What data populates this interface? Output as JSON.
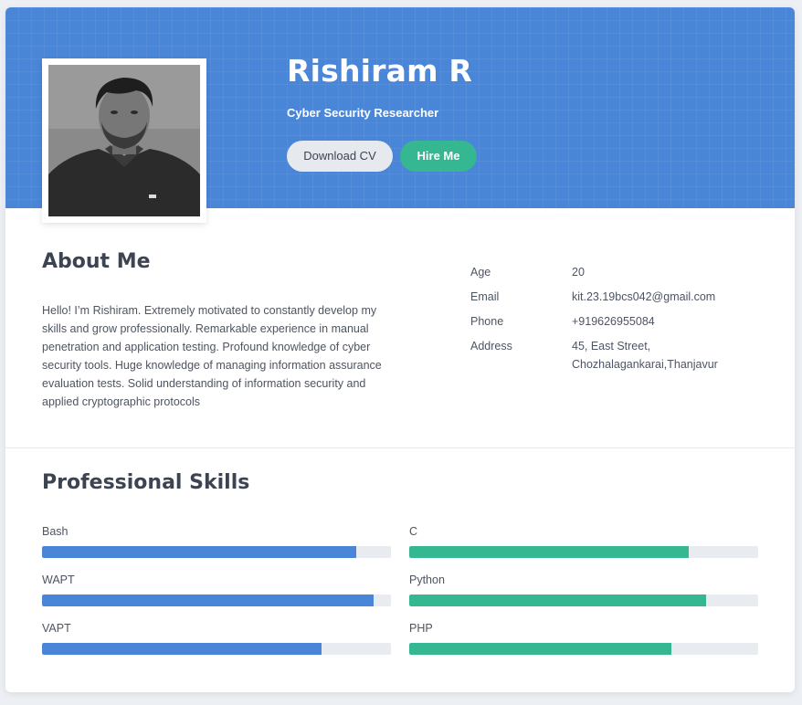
{
  "profile": {
    "name": "Rishiram R",
    "role": "Cyber Security Researcher",
    "download_cv_label": "Download CV",
    "hire_me_label": "Hire Me"
  },
  "about": {
    "title": "About Me",
    "text": "Hello! I’m Rishiram. Extremely motivated to constantly develop my skills and grow professionally. Remarkable experience in manual penetration and application testing. Profound knowledge of cyber security tools. Huge knowledge of managing information assurance evaluation tests. Solid understanding of information security and applied cryptographic protocols"
  },
  "info": [
    {
      "label": "Age",
      "value": "20"
    },
    {
      "label": "Email",
      "value": "kit.23.19bcs042@gmail.com"
    },
    {
      "label": "Phone",
      "value": "+919626955084"
    },
    {
      "label": "Address",
      "value": "45, East Street, Chozhalagankarai,Thanjavur"
    }
  ],
  "skills": {
    "title": "Professional Skills",
    "left": [
      {
        "label": "Bash",
        "level": 0.9
      },
      {
        "label": "WAPT",
        "level": 0.95
      },
      {
        "label": "VAPT",
        "level": 0.8
      }
    ],
    "right": [
      {
        "label": "C",
        "level": 0.8
      },
      {
        "label": "Python",
        "level": 0.85
      },
      {
        "label": "PHP",
        "level": 0.75
      }
    ]
  },
  "colors": {
    "header": "#4a86d8",
    "primary_bar": "#4a86d8",
    "accent_bar": "#35b891",
    "hire_button": "#35b891",
    "cv_button": "#e6e9ee",
    "track": "#e8ebef"
  }
}
